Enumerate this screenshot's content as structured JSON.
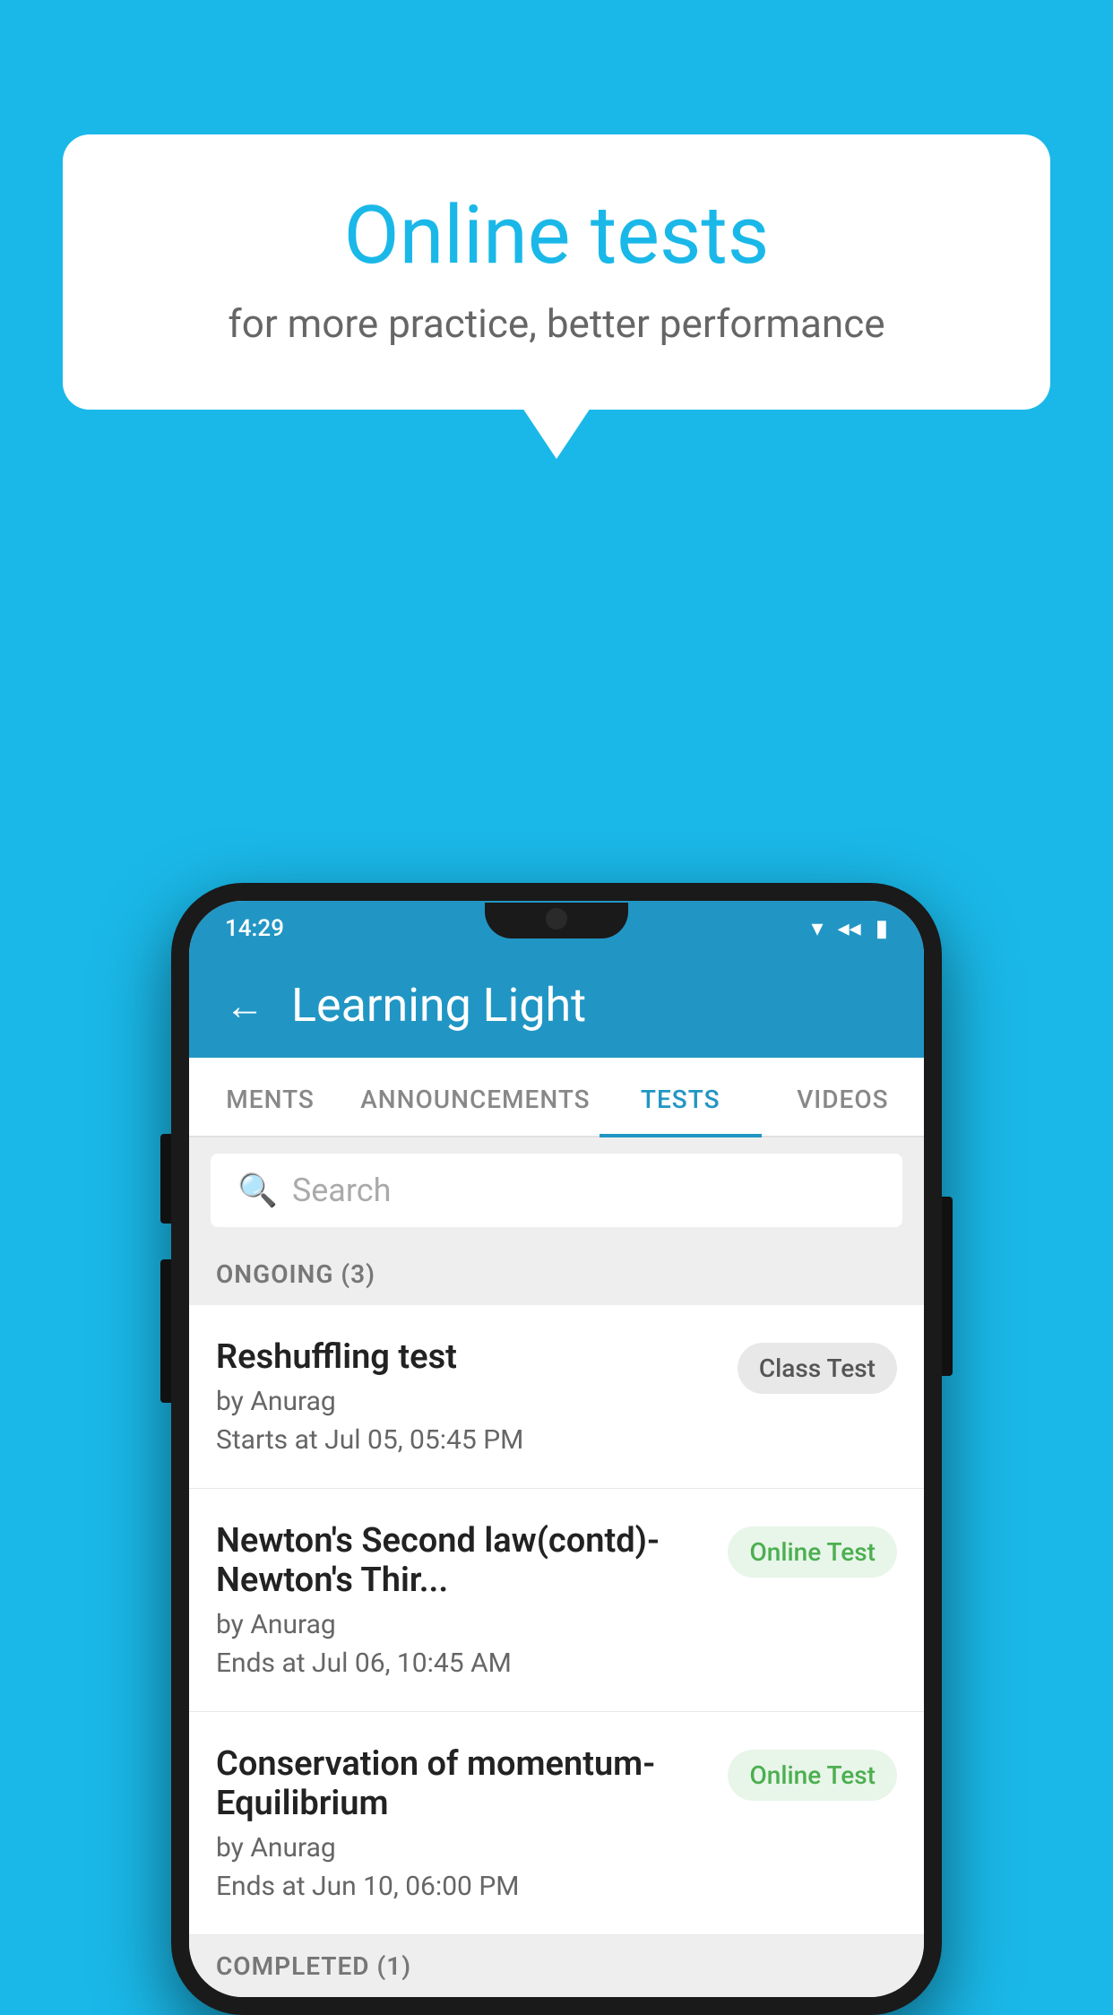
{
  "background_color": "#1ab8e8",
  "bubble": {
    "title": "Online tests",
    "subtitle": "for more practice, better performance"
  },
  "status_bar": {
    "time": "14:29",
    "wifi": "▼",
    "signal": "◀",
    "battery": "▮"
  },
  "app_bar": {
    "back_label": "←",
    "title": "Learning Light"
  },
  "tabs": [
    {
      "label": "MENTS",
      "active": false
    },
    {
      "label": "ANNOUNCEMENTS",
      "active": false
    },
    {
      "label": "TESTS",
      "active": true
    },
    {
      "label": "VIDEOS",
      "active": false
    }
  ],
  "search": {
    "placeholder": "Search"
  },
  "ongoing_section": {
    "title": "ONGOING (3)",
    "items": [
      {
        "name": "Reshuffling test",
        "author": "by Anurag",
        "date": "Starts at  Jul 05, 05:45 PM",
        "badge": "Class Test",
        "badge_type": "class"
      },
      {
        "name": "Newton's Second law(contd)-Newton's Thir...",
        "author": "by Anurag",
        "date": "Ends at  Jul 06, 10:45 AM",
        "badge": "Online Test",
        "badge_type": "online"
      },
      {
        "name": "Conservation of momentum-Equilibrium",
        "author": "by Anurag",
        "date": "Ends at  Jun 10, 06:00 PM",
        "badge": "Online Test",
        "badge_type": "online"
      }
    ]
  },
  "completed_section": {
    "title": "COMPLETED (1)"
  }
}
